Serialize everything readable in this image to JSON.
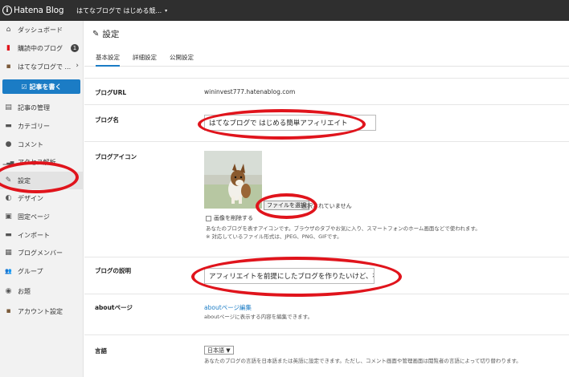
{
  "topbar": {
    "logo_mark": "i",
    "logo_text": "Hatena Blog",
    "blog_name": "はてなブログで はじめる競...",
    "caret": "▾"
  },
  "sidebar": {
    "items": [
      {
        "label": "ダッシュボード",
        "icon": "home-icon",
        "glyph": "⌂"
      },
      {
        "label": "購読中のブログ",
        "icon": "bookmark-icon",
        "glyph": "▮",
        "badge": "1"
      },
      {
        "label": "はてなブログで ...",
        "icon": "blog-thumb-icon",
        "glyph": "▪",
        "chevron": "›"
      },
      {
        "label": "記事の管理",
        "icon": "document-icon",
        "glyph": "▤"
      },
      {
        "label": "カテゴリー",
        "icon": "folder-icon",
        "glyph": "▬"
      },
      {
        "label": "コメント",
        "icon": "comment-icon",
        "glyph": "●"
      },
      {
        "label": "アクセス解析",
        "icon": "bar-chart-icon",
        "glyph": "▁▃▅"
      },
      {
        "label": "設定",
        "icon": "wrench-icon",
        "glyph": "✎"
      },
      {
        "label": "デザイン",
        "icon": "palette-icon",
        "glyph": "◐"
      },
      {
        "label": "固定ページ",
        "icon": "page-icon",
        "glyph": "▣"
      },
      {
        "label": "インポート",
        "icon": "truck-icon",
        "glyph": "▬"
      },
      {
        "label": "ブログメンバー",
        "icon": "members-icon",
        "glyph": "▦"
      },
      {
        "label": "グループ",
        "icon": "group-icon",
        "glyph": "👥"
      },
      {
        "label": "お題",
        "icon": "topic-icon",
        "glyph": "◉"
      },
      {
        "label": "アカウント設定",
        "icon": "account-icon",
        "glyph": "▪"
      }
    ],
    "write_button": "☑ 記事を書く"
  },
  "content": {
    "title_icon": "wrench-icon",
    "title_glyph": "✎",
    "title": "設定",
    "tabs": [
      "基本設定",
      "詳細設定",
      "公開設定"
    ],
    "blog_url_label": "ブログURL",
    "blog_url": "wininvest777.hatenablog.com",
    "blog_name_label": "ブログ名",
    "blog_name": "はてなブログで はじめる簡単アフィリエイト",
    "blog_icon_label": "ブログアイコン",
    "file_button": "ファイルを選択",
    "file_none": "選択されていません",
    "delete_image": "画像を削除する",
    "icon_note_1": "あなたのブログを表すアイコンです。ブラウザのタブやお気に入り、スマートフォンのホーム画面などで使われます。",
    "icon_note_2": "※ 対応しているファイル形式は、JPEG、PNG、GIFです。",
    "desc_label": "ブログの説明",
    "desc_value": "アフィリエイトを前提にしたブログを作りたいけど、初",
    "about_label": "aboutページ",
    "about_link": "aboutページ編集",
    "about_note": "aboutページに表示する内容を編集できます。",
    "lang_label": "言語",
    "lang_value": "日本語 ▼",
    "lang_note": "あなたのブログの言語を日本語または英語に設定できます。ただし、コメント画面や管理画面は閲覧者の言語によって切り替わります。"
  },
  "colors": {
    "accent": "#1b7cc5",
    "annotation": "#e0141c",
    "topbar": "#2f2f2f"
  }
}
